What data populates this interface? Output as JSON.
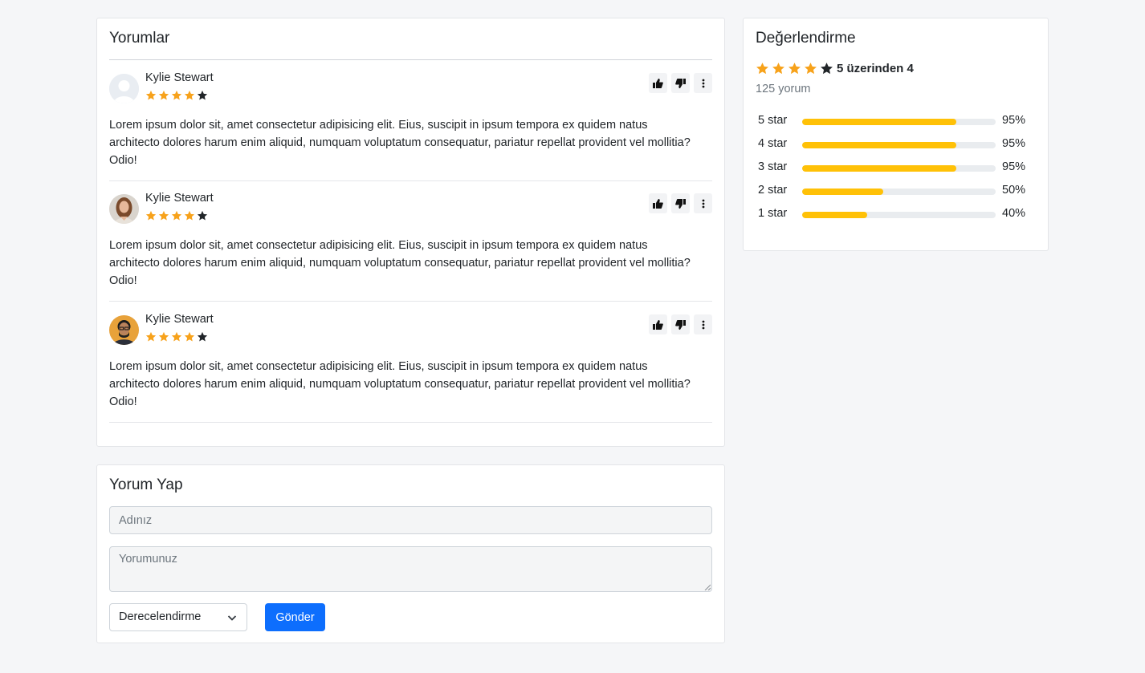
{
  "reviews_section": {
    "title": "Yorumlar",
    "reviews": [
      {
        "name": "Kylie Stewart",
        "rating": 4,
        "avatar": "placeholder-user-avatar",
        "text": "Lorem ipsum dolor sit, amet consectetur adipisicing elit. Eius, suscipit in ipsum tempora ex quidem natus architecto dolores harum enim aliquid, numquam voluptatum consequatur, pariatur repellat provident vel mollitia? Odio!"
      },
      {
        "name": "Kylie Stewart",
        "rating": 4,
        "avatar": "woman-photo-avatar",
        "text": "Lorem ipsum dolor sit, amet consectetur adipisicing elit. Eius, suscipit in ipsum tempora ex quidem natus architecto dolores harum enim aliquid, numquam voluptatum consequatur, pariatur repellat provident vel mollitia? Odio!"
      },
      {
        "name": "Kylie Stewart",
        "rating": 4,
        "avatar": "man-photo-avatar",
        "text": "Lorem ipsum dolor sit, amet consectetur adipisicing elit. Eius, suscipit in ipsum tempora ex quidem natus architecto dolores harum enim aliquid, numquam voluptatum consequatur, pariatur repellat provident vel mollitia? Odio!"
      }
    ],
    "actions": [
      "thumbs-up-icon",
      "thumbs-down-icon",
      "more-vertical-icon"
    ]
  },
  "rating_summary": {
    "title": "Değerlendirme",
    "rating": 4,
    "summary_text": "5 üzerinden 4",
    "review_count": "125 yorum",
    "distribution": [
      {
        "label": "5 star",
        "percent": 95,
        "percent_text": "95%"
      },
      {
        "label": "4 star",
        "percent": 95,
        "percent_text": "95%"
      },
      {
        "label": "3 star",
        "percent": 95,
        "percent_text": "95%"
      },
      {
        "label": "2 star",
        "percent": 50,
        "percent_text": "50%"
      },
      {
        "label": "1 star",
        "percent": 40,
        "percent_text": "40%"
      }
    ]
  },
  "review_form": {
    "title": "Yorum Yap",
    "name_placeholder": "Adınız",
    "comment_placeholder": "Yorumunuz",
    "rating_select": "Derecelendirme",
    "submit_label": "Gönder"
  },
  "colors": {
    "star_filled": "#f7a21b",
    "star_empty": "#212529",
    "progress_fill": "#ffc107",
    "progress_track": "#e9ecef",
    "submit_button": "#0d6efd"
  }
}
